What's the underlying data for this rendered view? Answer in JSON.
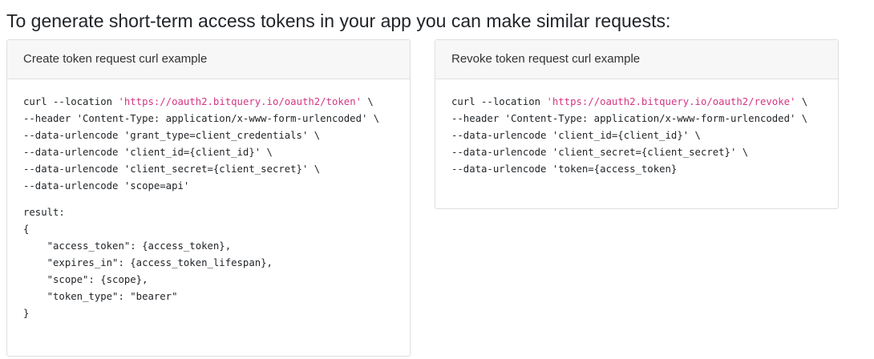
{
  "heading": "To generate short-term access tokens in your app you can make similar requests:",
  "create_card": {
    "title": "Create token request curl example",
    "curl_prefix": "curl --location ",
    "url": "'https://oauth2.bitquery.io/oauth2/token'",
    "url_suffix": " \\",
    "lines": [
      "--header 'Content-Type: application/x-www-form-urlencoded' \\",
      "--data-urlencode 'grant_type=client_credentials' \\",
      "--data-urlencode 'client_id={client_id}' \\",
      "--data-urlencode 'client_secret={client_secret}' \\",
      "--data-urlencode 'scope=api'"
    ],
    "result_lines": [
      "result:",
      "{",
      "    \"access_token\": {access_token},",
      "    \"expires_in\": {access_token_lifespan},",
      "    \"scope\": {scope},",
      "    \"token_type\": \"bearer\"",
      "}"
    ]
  },
  "revoke_card": {
    "title": "Revoke token request curl example",
    "curl_prefix": "curl --location ",
    "url": "'https://oauth2.bitquery.io/oauth2/revoke'",
    "url_suffix": " \\",
    "lines": [
      "--header 'Content-Type: application/x-www-form-urlencoded' \\",
      "--data-urlencode 'client_id={client_id}' \\",
      "--data-urlencode 'client_secret={client_secret}' \\",
      "--data-urlencode 'token={access_token}"
    ]
  },
  "colors": {
    "url": "#d33682",
    "header_bg": "#f7f7f7",
    "border": "#dfdfdf",
    "text": "#212529"
  }
}
